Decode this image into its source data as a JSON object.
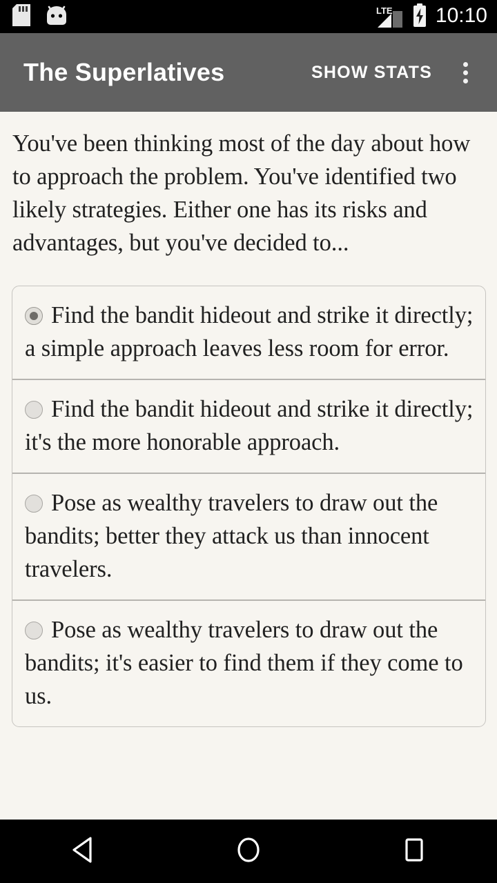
{
  "status_bar": {
    "icons_left": [
      "sd-card-icon",
      "android-head-icon"
    ],
    "network_label": "LTE",
    "icons_right": [
      "signal-icon",
      "battery-charging-icon"
    ],
    "time": "10:10"
  },
  "app_bar": {
    "title": "The Superlatives",
    "action_label": "SHOW STATS",
    "overflow_icon": "more-vert-icon"
  },
  "story": {
    "text": "You've been thinking most of the day about how to approach the problem. You've identified two likely strategies. Either one has its risks and advantages, but you've decided to..."
  },
  "options": [
    {
      "id": "option-1",
      "selected": true,
      "label": "Find the bandit hideout and strike it directly; a simple approach leaves less room for error."
    },
    {
      "id": "option-2",
      "selected": false,
      "label": "Find the bandit hideout and strike it directly; it's the more honorable approach."
    },
    {
      "id": "option-3",
      "selected": false,
      "label": "Pose as wealthy travelers to draw out the bandits; better they attack us than innocent travelers."
    },
    {
      "id": "option-4",
      "selected": false,
      "label": "Pose as wealthy travelers to draw out the bandits; it's easier to find them if they come to us."
    }
  ],
  "nav_bar": {
    "back_icon": "back-triangle-icon",
    "home_icon": "home-circle-icon",
    "recents_icon": "recents-square-icon"
  },
  "colors": {
    "app_bar": "#616161",
    "page_background": "#f7f5f0",
    "text": "#212121",
    "card_border": "#c6c4c0",
    "system_bar": "#000000"
  }
}
